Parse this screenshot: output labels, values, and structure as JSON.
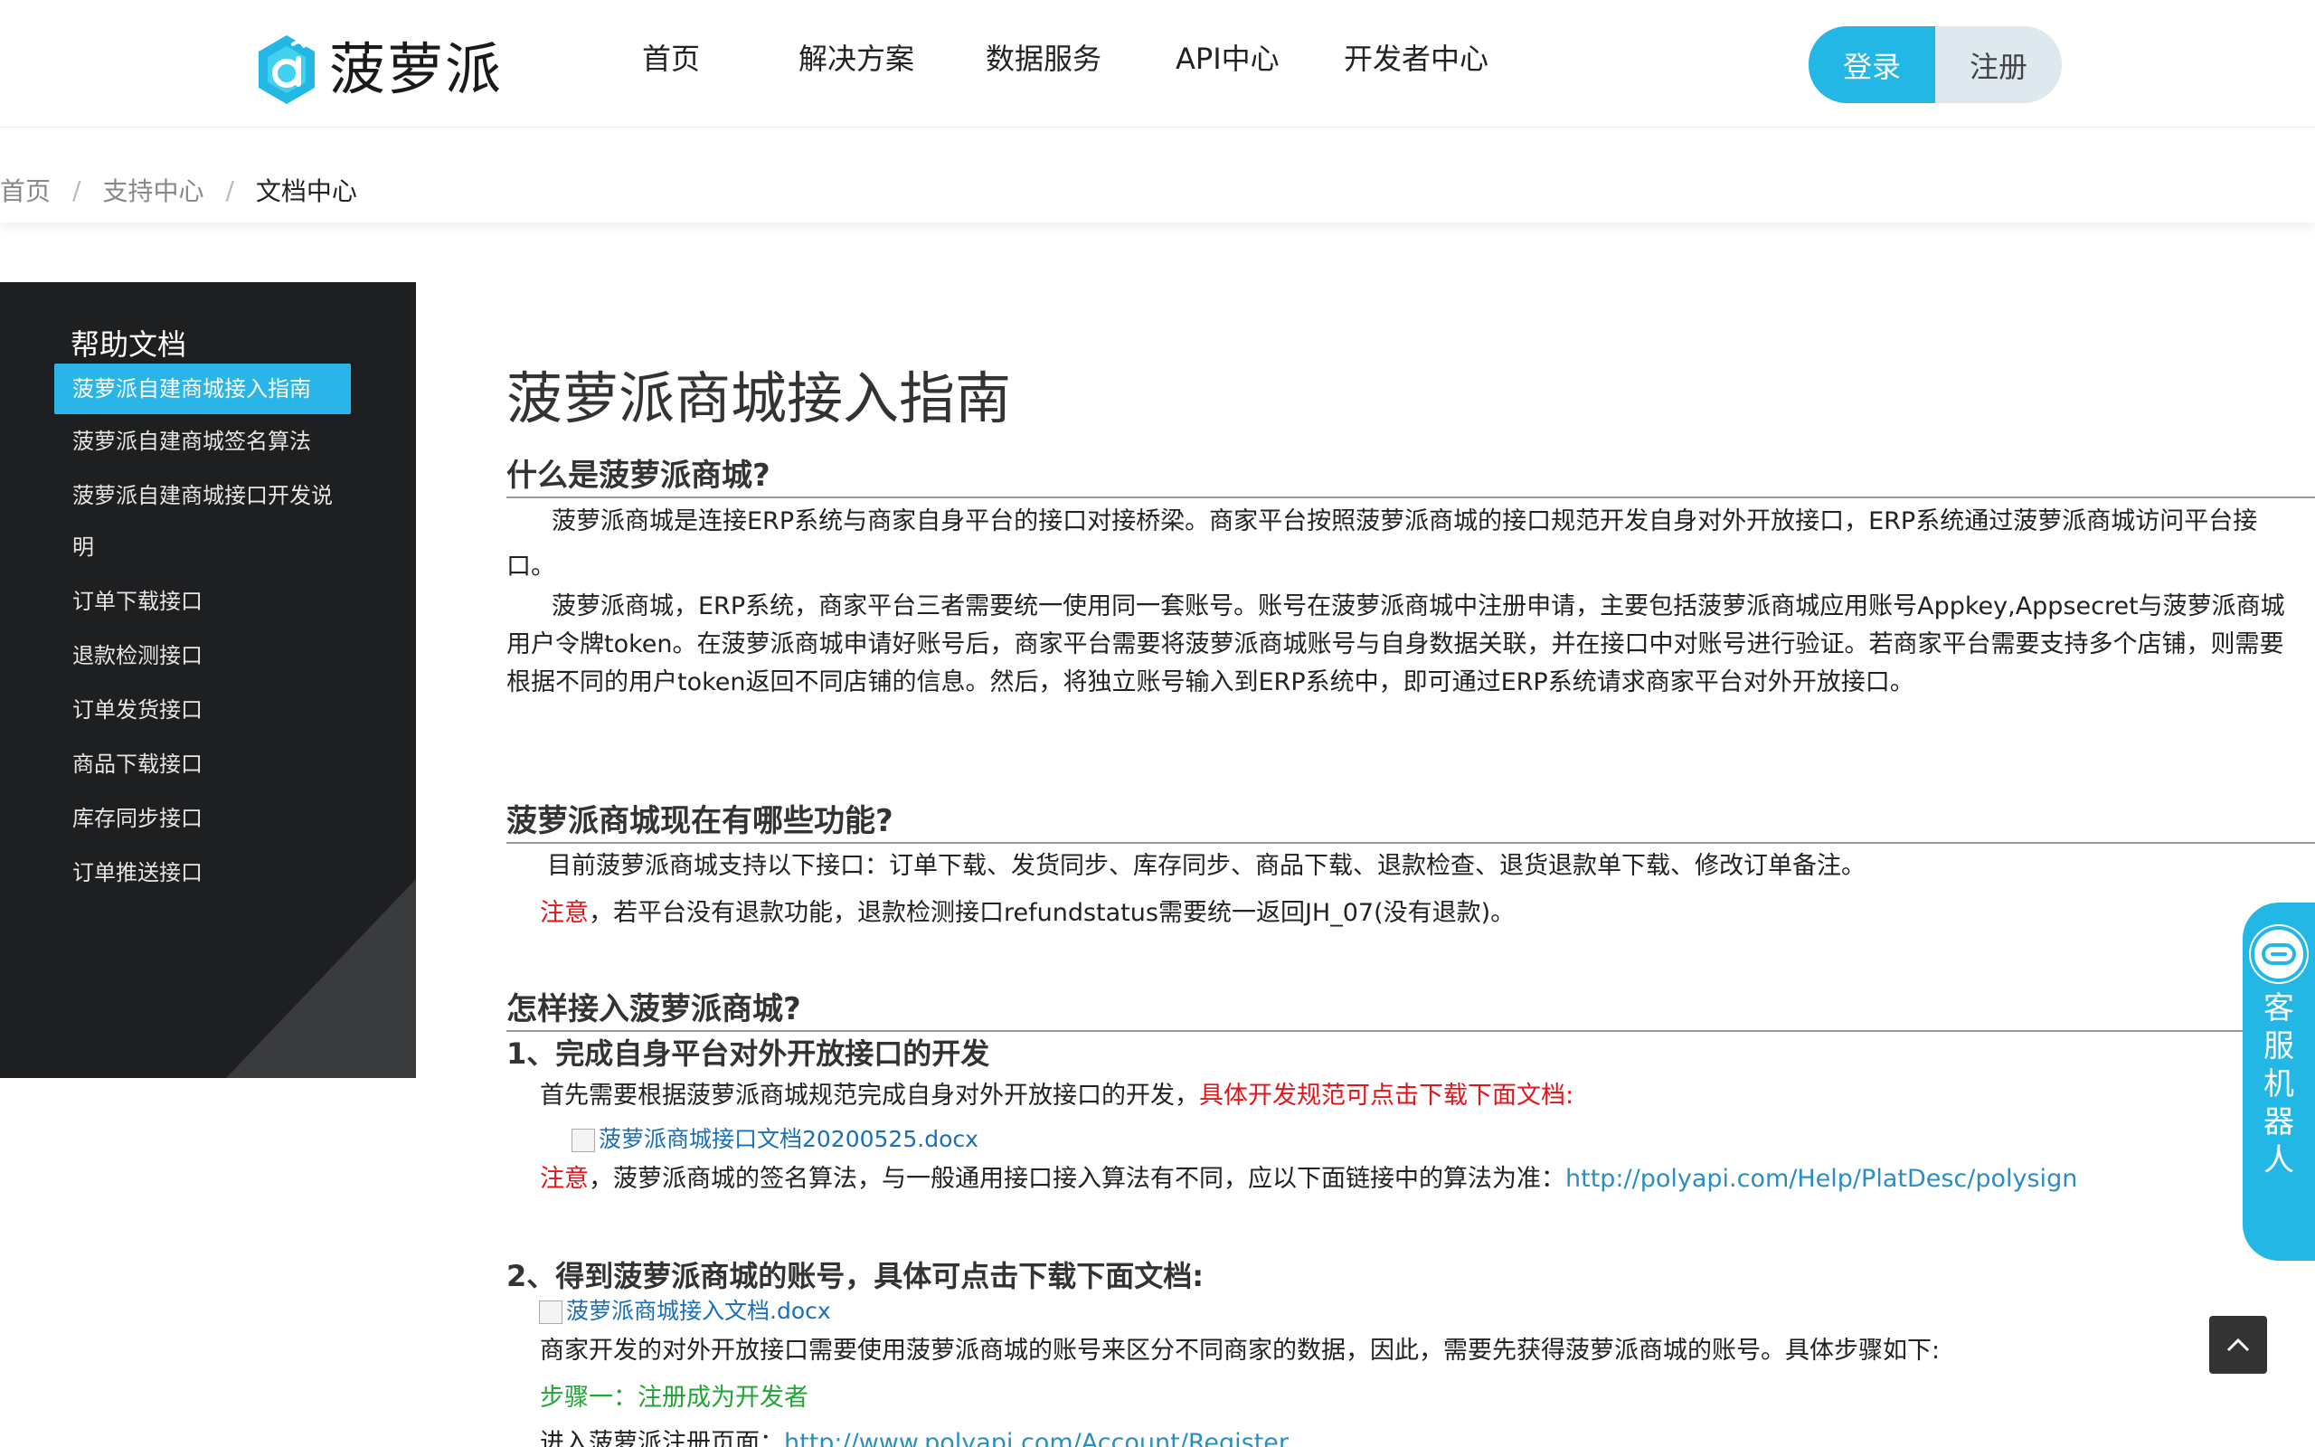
{
  "header": {
    "logo_text": "菠萝派",
    "nav": [
      "首页",
      "解决方案",
      "数据服务",
      "API中心",
      "开发者中心"
    ],
    "login_label": "登录",
    "register_label": "注册"
  },
  "breadcrumb": {
    "items": [
      "首页",
      "支持中心",
      "文档中心"
    ],
    "separator": "/"
  },
  "sidebar": {
    "title": "帮助文档",
    "items": [
      "菠萝派自建商城接入指南",
      "菠萝派自建商城签名算法",
      "菠萝派自建商城接口开发说",
      "明",
      "订单下载接口",
      "退款检测接口",
      "订单发货接口",
      "商品下载接口",
      "库存同步接口",
      "订单推送接口"
    ]
  },
  "content": {
    "title": "菠萝派商城接入指南",
    "s1_title": "什么是菠萝派商城?",
    "s1_p1": "菠萝派商城是连接ERP系统与商家自身平台的接口对接桥梁。商家平台按照菠萝派商城的接口规范开发自身对外开放接口，ERP系统通过菠萝派商城访问平台接口。",
    "s1_p2": "菠萝派商城，ERP系统，商家平台三者需要统一使用同一套账号。账号在菠萝派商城中注册申请，主要包括菠萝派商城应用账号Appkey,Appsecret与菠萝派商城用户令牌token。在菠萝派商城申请好账号后，商家平台需要将菠萝派商城账号与自身数据关联，并在接口中对账号进行验证。若商家平台需要支持多个店铺，则需要根据不同的用户token返回不同店铺的信息。然后，将独立账号输入到ERP系统中，即可通过ERP系统请求商家平台对外开放接口。",
    "s2_title": "菠萝派商城现在有哪些功能?",
    "s2_line1": "目前菠萝派商城支持以下接口：订单下载、发货同步、库存同步、商品下载、退款检查、退货退款单下载、修改订单备注。",
    "s2_note_label": "注意",
    "s2_note_text": "，若平台没有退款功能，退款检测接口refundstatus需要统一返回JH_07(没有退款)。",
    "s3_title": "怎样接入菠萝派商城?",
    "s3_step1_title": "1、完成自身平台对外开放接口的开发",
    "s3_step1_text": "首先需要根据菠萝派商城规范完成自身对外开放接口的开发，",
    "s3_step1_red": "具体开发规范可点击下载下面文档:",
    "s3_doc1": "菠萝派商城接口文档20200525.docx",
    "s3_note_label": "注意",
    "s3_note_text": "，菠萝派商城的签名算法，与一般通用接口接入算法有不同，应以下面链接中的算法为准：",
    "s3_note_link": "http://polyapi.com/Help/PlatDesc/polysign",
    "s3_step2_title": "2、得到菠萝派商城的账号，具体可点击下载下面文档:",
    "s3_doc2": "菠萝派商城接入文档.docx",
    "s3_step2_text": "商家开发的对外开放接口需要使用菠萝派商城的账号来区分不同商家的数据，因此，需要先获得菠萝派商城的账号。具体步骤如下:",
    "s3_step_a": "步骤一：注册成为开发者",
    "s3_reg_text": "进入菠萝派注册页面：",
    "s3_reg_link": "http://www.polyapi.com/Account/Register"
  },
  "chat": {
    "label_chars": [
      "客",
      "服",
      "机",
      "器",
      "人"
    ]
  },
  "colors": {
    "accent": "#23b7e5",
    "sidebar_bg": "#1e1f21",
    "active_item": "#2ab5e8",
    "note_red": "#e4151a",
    "step_green": "#21a634",
    "link": "#2a8fc0"
  }
}
